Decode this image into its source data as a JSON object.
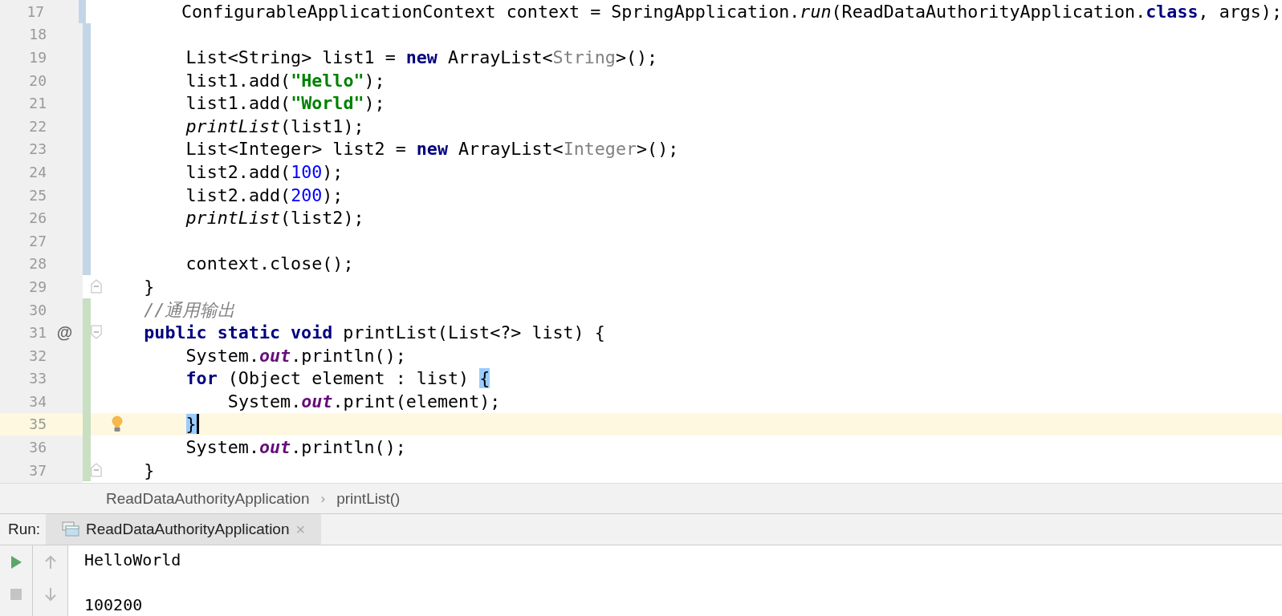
{
  "editor": {
    "lines": [
      {
        "children": [
          {
            "number": "17",
            "color": "#c3d6e8",
            "current": false,
            "bulb": false,
            "caret": false,
            "tokens": [
              {
                "kind": "plain",
                "text": "ConfigurableApplicationContext context = SpringApplication."
              },
              {
                "kind": "static-call",
                "text": "run"
              },
              {
                "kind": "plain",
                "text": "(ReadDataAuthorityApplication."
              },
              {
                "kind": "keyword",
                "text": "class"
              },
              {
                "kind": "plain",
                "text": ", args);"
              }
            ]
          },
          {
            "number": "18",
            "color": "#c3d6e8",
            "current": false,
            "bulb": false,
            "caret": false
          },
          {
            "number": "19",
            "color": "#c3d6e8",
            "current": false,
            "bulb": false,
            "caret": false,
            "tokens": [
              {
                "kind": "plain",
                "text": "List<String> list1 = "
              },
              {
                "kind": "keyword",
                "text": "new"
              },
              {
                "kind": "plain",
                "text": " ArrayList<"
              },
              {
                "kind": "type-arg",
                "text": "String"
              },
              {
                "kind": "plain",
                "text": ">();"
              }
            ]
          },
          {
            "number": "20",
            "color": "#c3d6e8",
            "current": false,
            "bulb": false,
            "caret": false,
            "tokens": [
              {
                "kind": "plain",
                "text": "list1.add("
              },
              {
                "kind": "string",
                "text": "\"Hello\""
              },
              {
                "kind": "plain",
                "text": ");"
              }
            ]
          },
          {
            "number": "21",
            "color": "#c3d6e8",
            "current": false,
            "bulb": false,
            "caret": false,
            "tokens": [
              {
                "kind": "plain",
                "text": "list1.add("
              },
              {
                "kind": "string",
                "text": "\"World\""
              },
              {
                "kind": "plain",
                "text": ");"
              }
            ]
          },
          {
            "number": "22",
            "color": "#c3d6e8",
            "current": false,
            "bulb": false,
            "caret": false,
            "tokens": [
              {
                "kind": "static-call",
                "text": "printList"
              },
              {
                "kind": "plain",
                "text": "(list1);"
              }
            ]
          },
          {
            "number": "23",
            "color": "#c3d6e8",
            "current": false,
            "bulb": false,
            "caret": false,
            "tokens": [
              {
                "kind": "plain",
                "text": "List<Integer> list2 = "
              },
              {
                "kind": "keyword",
                "text": "new"
              },
              {
                "kind": "plain",
                "text": " ArrayList<"
              },
              {
                "kind": "type-arg",
                "text": "Integer"
              },
              {
                "kind": "plain",
                "text": ">();"
              }
            ]
          },
          {
            "number": "24",
            "color": "#c3d6e8",
            "current": false,
            "bulb": false,
            "caret": false,
            "tokens": [
              {
                "kind": "plain",
                "text": "list2.add("
              },
              {
                "kind": "number",
                "text": "100"
              },
              {
                "kind": "plain",
                "text": ");"
              }
            ]
          },
          {
            "number": "25",
            "color": "#c3d6e8",
            "current": false,
            "bulb": false,
            "caret": false,
            "tokens": [
              {
                "kind": "plain",
                "text": "list2.add("
              },
              {
                "kind": "number",
                "text": "200"
              },
              {
                "kind": "plain",
                "text": ");"
              }
            ]
          },
          {
            "number": "26",
            "color": "#c3d6e8",
            "current": false,
            "bulb": false,
            "caret": false,
            "tokens": [
              {
                "kind": "static-call",
                "text": "printList"
              },
              {
                "kind": "plain",
                "text": "(list2);"
              }
            ]
          },
          {
            "number": "27",
            "color": "#c3d6e8",
            "current": false,
            "bulb": false,
            "caret": false
          },
          {
            "number": "28",
            "color": "#c3d6e8",
            "current": false,
            "bulb": false,
            "caret": false,
            "tokens": [
              {
                "kind": "plain",
                "text": "context.close();"
              }
            ]
          }
        ]
      },
      {
        "number": "29",
        "fold_marker": {
          "kind": "end"
        },
        "current": false,
        "bulb": false,
        "caret": false,
        "tokens": [
          {
            "kind": "plain",
            "text": "}"
          }
        ]
      },
      {
        "number": "30",
        "color": "#c9dfc1",
        "current": false,
        "bulb": false,
        "caret": false,
        "tokens": [
          {
            "kind": "comment",
            "text": "//通用输出"
          }
        ]
      },
      {
        "number": "31",
        "color": "#c9dfc1",
        "fold_marker": {
          "kind": "start"
        },
        "gutter_mark": "@",
        "current": false,
        "bulb": false,
        "caret": false,
        "tokens": [
          {
            "kind": "keyword",
            "text": "public static void"
          },
          {
            "kind": "plain",
            "text": " printList(List<?> list) {"
          }
        ]
      },
      {
        "children": [
          {
            "number": "32",
            "color": "#c9dfc1",
            "current": false,
            "bulb": false,
            "caret": false,
            "tokens": [
              {
                "kind": "plain",
                "text": "System."
              },
              {
                "kind": "field",
                "text": "out"
              },
              {
                "kind": "plain",
                "text": ".println();"
              }
            ]
          },
          {
            "number": "33",
            "color": "#c9dfc1",
            "current": false,
            "bulb": false,
            "caret": false,
            "tokens": [
              {
                "kind": "keyword",
                "text": "for"
              },
              {
                "kind": "plain",
                "text": " (Object element : list) "
              },
              {
                "kind": "brace-match",
                "text": "{"
              }
            ]
          },
          {
            "children": [
              {
                "number": "34",
                "color": "#c9dfc1",
                "current": false,
                "bulb": false,
                "caret": false,
                "tokens": [
                  {
                    "kind": "plain",
                    "text": "System."
                  },
                  {
                    "kind": "field",
                    "text": "out"
                  },
                  {
                    "kind": "plain",
                    "text": ".print(element);"
                  }
                ]
              }
            ]
          },
          {
            "number": "35",
            "color": "#c9dfc1",
            "current": true,
            "bulb": true,
            "caret": true,
            "tokens": [
              {
                "kind": "brace-match",
                "text": "}"
              }
            ]
          },
          {
            "number": "36",
            "color": "#c9dfc1",
            "current": false,
            "bulb": false,
            "caret": false,
            "tokens": [
              {
                "kind": "plain",
                "text": "System."
              },
              {
                "kind": "field",
                "text": "out"
              },
              {
                "kind": "plain",
                "text": ".println();"
              }
            ]
          }
        ]
      },
      {
        "number": "37",
        "color": "#c9dfc1",
        "fold_marker": {
          "kind": "end"
        },
        "current": false,
        "bulb": false,
        "caret": false,
        "tokens": [
          {
            "kind": "plain",
            "text": "}"
          }
        ]
      }
    ]
  },
  "breadcrumbs": [
    "ReadDataAuthorityApplication",
    "›",
    "printList()"
  ],
  "run_panel": {
    "label": "Run:",
    "tabs": [
      {
        "title": "ReadDataAuthorityApplication",
        "close": "×",
        "selected": true
      }
    ],
    "output": [
      "HelloWorld",
      "100200"
    ]
  }
}
